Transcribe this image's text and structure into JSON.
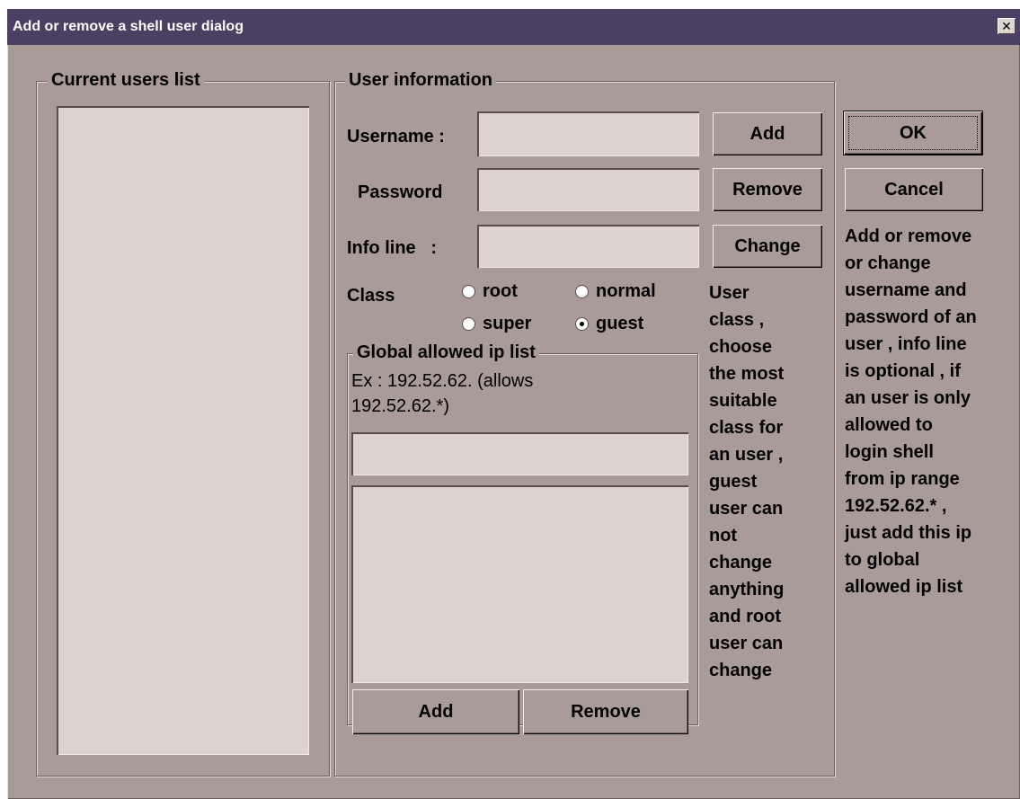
{
  "window": {
    "title": "Add or remove a shell user dialog",
    "close_glyph": "✕",
    "colors": {
      "face": "#a99c98",
      "titlebar": "#4b4064",
      "field": "#dcd3cf"
    }
  },
  "users_group": {
    "legend": "Current users list",
    "items": []
  },
  "user_info": {
    "legend": "User information",
    "username_label": "Username :",
    "username_value": "",
    "password_label": "Password",
    "password_value": "",
    "infoline_label": "Info line   :",
    "infoline_value": "",
    "add_label": "Add",
    "remove_label": "Remove",
    "change_label": "Change",
    "class_label": "Class",
    "class_options": {
      "root": "root",
      "normal": "normal",
      "super": "super",
      "guest": "guest"
    },
    "class_selected": "guest",
    "class_help": "User\nclass ,\nchoose\nthe most\nsuitable\nclass for\nan user ,\nguest\nuser can\nnot\nchange\nanything\nand root\nuser can\nchange"
  },
  "ip_group": {
    "legend": "Global allowed ip list",
    "example": "Ex : 192.52.62. (allows\n192.52.62.*)",
    "ip_input_value": "",
    "items": [],
    "add_label": "Add",
    "remove_label": "Remove"
  },
  "actions": {
    "ok_label": "OK",
    "cancel_label": "Cancel",
    "help_text": "Add or remove\nor change\nusername and\npassword of an\nuser , info line\nis optional , if\nan user is only\nallowed to\nlogin shell\nfrom ip range\n192.52.62.* ,\njust add this ip\nto global\nallowed ip list"
  }
}
